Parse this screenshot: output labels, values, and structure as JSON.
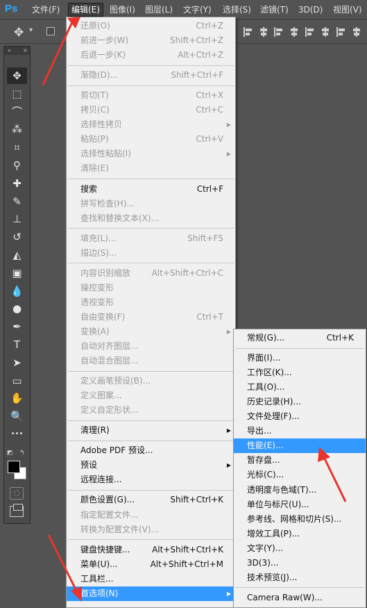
{
  "app": {
    "logo": "Ps"
  },
  "menubar": [
    {
      "label": "文件(F)",
      "active": false
    },
    {
      "label": "编辑(E)",
      "active": true
    },
    {
      "label": "图像(I)",
      "active": false
    },
    {
      "label": "图层(L)",
      "active": false
    },
    {
      "label": "文字(Y)",
      "active": false
    },
    {
      "label": "选择(S)",
      "active": false
    },
    {
      "label": "滤镜(T)",
      "active": false
    },
    {
      "label": "3D(D)",
      "active": false
    },
    {
      "label": "视图(V)",
      "active": false
    }
  ],
  "options_bar": {
    "move_icon": "move-icon",
    "chevron": "chevron-down-icon"
  },
  "toolbar": {
    "header_collapse": "»",
    "header_close": "×",
    "tools": [
      {
        "name": "move-tool",
        "icon": "✥"
      },
      {
        "name": "marquee-tool",
        "icon": "⬚"
      },
      {
        "name": "lasso-tool",
        "icon": "⌒"
      },
      {
        "name": "magic-wand-tool",
        "icon": "⁂"
      },
      {
        "name": "crop-tool",
        "icon": "⌗"
      },
      {
        "name": "eyedropper-tool",
        "icon": "⚲"
      },
      {
        "name": "healing-brush-tool",
        "icon": "✚"
      },
      {
        "name": "brush-tool",
        "icon": "✎"
      },
      {
        "name": "clone-stamp-tool",
        "icon": "⊥"
      },
      {
        "name": "history-brush-tool",
        "icon": "↺"
      },
      {
        "name": "eraser-tool",
        "icon": "◭"
      },
      {
        "name": "gradient-tool",
        "icon": "▣"
      },
      {
        "name": "blur-tool",
        "icon": "💧"
      },
      {
        "name": "dodge-tool",
        "icon": "●"
      },
      {
        "name": "pen-tool",
        "icon": "✒"
      },
      {
        "name": "type-tool",
        "icon": "T"
      },
      {
        "name": "path-selection-tool",
        "icon": "➤"
      },
      {
        "name": "rectangle-tool",
        "icon": "▭"
      },
      {
        "name": "hand-tool",
        "icon": "✋"
      },
      {
        "name": "zoom-tool",
        "icon": "🔍"
      },
      {
        "name": "more-tools",
        "icon": "•••"
      }
    ],
    "foreground_color": "#000000",
    "background_color": "#ffffff"
  },
  "edit_menu": {
    "items": [
      {
        "label": "还原(O)",
        "shortcut": "Ctrl+Z",
        "enabled": false,
        "submenu": false
      },
      {
        "label": "前进一步(W)",
        "shortcut": "Shift+Ctrl+Z",
        "enabled": false,
        "submenu": false
      },
      {
        "label": "后退一步(K)",
        "shortcut": "Alt+Ctrl+Z",
        "enabled": false,
        "submenu": false
      },
      {
        "sep": true
      },
      {
        "label": "渐隐(D)...",
        "shortcut": "Shift+Ctrl+F",
        "enabled": false,
        "submenu": false
      },
      {
        "sep": true
      },
      {
        "label": "剪切(T)",
        "shortcut": "Ctrl+X",
        "enabled": false,
        "submenu": false
      },
      {
        "label": "拷贝(C)",
        "shortcut": "Ctrl+C",
        "enabled": false,
        "submenu": false
      },
      {
        "label": "选择性拷贝",
        "shortcut": "",
        "enabled": false,
        "submenu": true
      },
      {
        "label": "粘贴(P)",
        "shortcut": "Ctrl+V",
        "enabled": false,
        "submenu": false
      },
      {
        "label": "选择性粘贴(I)",
        "shortcut": "",
        "enabled": false,
        "submenu": true
      },
      {
        "label": "清除(E)",
        "shortcut": "",
        "enabled": false,
        "submenu": false
      },
      {
        "sep": true
      },
      {
        "label": "搜索",
        "shortcut": "Ctrl+F",
        "enabled": true,
        "submenu": false
      },
      {
        "label": "拼写检查(H)...",
        "shortcut": "",
        "enabled": false,
        "submenu": false
      },
      {
        "label": "查找和替换文本(X)...",
        "shortcut": "",
        "enabled": false,
        "submenu": false
      },
      {
        "sep": true
      },
      {
        "label": "填充(L)...",
        "shortcut": "Shift+F5",
        "enabled": false,
        "submenu": false
      },
      {
        "label": "描边(S)...",
        "shortcut": "",
        "enabled": false,
        "submenu": false
      },
      {
        "sep": true
      },
      {
        "label": "内容识别缩放",
        "shortcut": "Alt+Shift+Ctrl+C",
        "enabled": false,
        "submenu": false
      },
      {
        "label": "操控变形",
        "shortcut": "",
        "enabled": false,
        "submenu": false
      },
      {
        "label": "透视变形",
        "shortcut": "",
        "enabled": false,
        "submenu": false
      },
      {
        "label": "自由变换(F)",
        "shortcut": "Ctrl+T",
        "enabled": false,
        "submenu": false
      },
      {
        "label": "变换(A)",
        "shortcut": "",
        "enabled": false,
        "submenu": true
      },
      {
        "label": "自动对齐图层...",
        "shortcut": "",
        "enabled": false,
        "submenu": false
      },
      {
        "label": "自动混合图层...",
        "shortcut": "",
        "enabled": false,
        "submenu": false
      },
      {
        "sep": true
      },
      {
        "label": "定义画笔预设(B)...",
        "shortcut": "",
        "enabled": false,
        "submenu": false
      },
      {
        "label": "定义图案...",
        "shortcut": "",
        "enabled": false,
        "submenu": false
      },
      {
        "label": "定义自定形状...",
        "shortcut": "",
        "enabled": false,
        "submenu": false
      },
      {
        "sep": true
      },
      {
        "label": "清理(R)",
        "shortcut": "",
        "enabled": true,
        "submenu": true
      },
      {
        "sep": true
      },
      {
        "label": "Adobe PDF 预设...",
        "shortcut": "",
        "enabled": true,
        "submenu": false
      },
      {
        "label": "预设",
        "shortcut": "",
        "enabled": true,
        "submenu": true
      },
      {
        "label": "远程连接...",
        "shortcut": "",
        "enabled": true,
        "submenu": false
      },
      {
        "sep": true
      },
      {
        "label": "颜色设置(G)...",
        "shortcut": "Shift+Ctrl+K",
        "enabled": true,
        "submenu": false
      },
      {
        "label": "指定配置文件...",
        "shortcut": "",
        "enabled": false,
        "submenu": false
      },
      {
        "label": "转换为配置文件(V)...",
        "shortcut": "",
        "enabled": false,
        "submenu": false
      },
      {
        "sep": true
      },
      {
        "label": "键盘快捷键...",
        "shortcut": "Alt+Shift+Ctrl+K",
        "enabled": true,
        "submenu": false
      },
      {
        "label": "菜单(U)...",
        "shortcut": "Alt+Shift+Ctrl+M",
        "enabled": true,
        "submenu": false
      },
      {
        "label": "工具栏...",
        "shortcut": "",
        "enabled": true,
        "submenu": false
      },
      {
        "label": "首选项(N)",
        "shortcut": "",
        "enabled": true,
        "submenu": true,
        "highlighted": true
      }
    ]
  },
  "preferences_menu": {
    "items": [
      {
        "label": "常规(G)...",
        "shortcut": "Ctrl+K",
        "enabled": true
      },
      {
        "sep": true
      },
      {
        "label": "界面(I)...",
        "shortcut": "",
        "enabled": true
      },
      {
        "label": "工作区(K)...",
        "shortcut": "",
        "enabled": true
      },
      {
        "label": "工具(O)...",
        "shortcut": "",
        "enabled": true
      },
      {
        "label": "历史记录(H)...",
        "shortcut": "",
        "enabled": true
      },
      {
        "label": "文件处理(F)...",
        "shortcut": "",
        "enabled": true
      },
      {
        "label": "导出...",
        "shortcut": "",
        "enabled": true
      },
      {
        "label": "性能(E)...",
        "shortcut": "",
        "enabled": true,
        "highlighted": true
      },
      {
        "label": "暂存盘...",
        "shortcut": "",
        "enabled": true
      },
      {
        "label": "光标(C)...",
        "shortcut": "",
        "enabled": true
      },
      {
        "label": "透明度与色域(T)...",
        "shortcut": "",
        "enabled": true
      },
      {
        "label": "单位与标尺(U)...",
        "shortcut": "",
        "enabled": true
      },
      {
        "label": "参考线、网格和切片(S)...",
        "shortcut": "",
        "enabled": true
      },
      {
        "label": "增效工具(P)...",
        "shortcut": "",
        "enabled": true
      },
      {
        "label": "文字(Y)...",
        "shortcut": "",
        "enabled": true
      },
      {
        "label": "3D(3)...",
        "shortcut": "",
        "enabled": true
      },
      {
        "label": "技术预览(J)...",
        "shortcut": "",
        "enabled": true
      },
      {
        "sep": true
      },
      {
        "label": "Camera Raw(W)...",
        "shortcut": "",
        "enabled": true
      }
    ]
  },
  "colors": {
    "highlight": "#3399ff",
    "annotation_arrow": "#e8342c",
    "ps_blue": "#31a8ff"
  }
}
